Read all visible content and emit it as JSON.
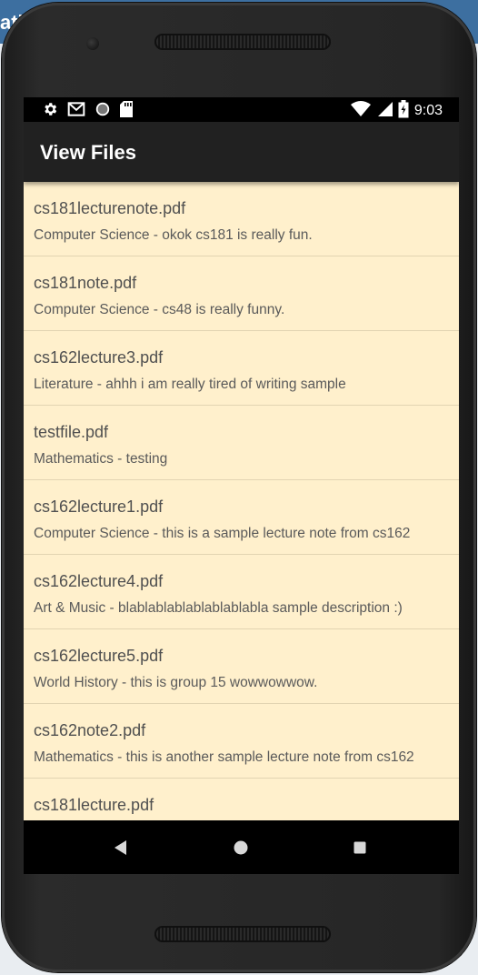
{
  "backdrop": {
    "title_fragment": "ati"
  },
  "status_bar": {
    "time": "9:03",
    "icons": [
      "gear-icon",
      "gmail-icon",
      "circle-icon",
      "sd-card-icon",
      "wifi-icon",
      "signal-icon",
      "battery-icon"
    ]
  },
  "app_bar": {
    "title": "View Files"
  },
  "files": [
    {
      "name": "cs181lecturenote.pdf",
      "description": "Computer Science - okok cs181 is really fun."
    },
    {
      "name": "cs181note.pdf",
      "description": "Computer Science - cs48 is really funny."
    },
    {
      "name": "cs162lecture3.pdf",
      "description": "Literature - ahhh i am really tired of writing sample"
    },
    {
      "name": "testfile.pdf",
      "description": "Mathematics - testing"
    },
    {
      "name": "cs162lecture1.pdf",
      "description": "Computer Science - this is a sample lecture note from cs162"
    },
    {
      "name": "cs162lecture4.pdf",
      "description": "Art & Music - blablablablablablablabla sample description :)"
    },
    {
      "name": "cs162lecture5.pdf",
      "description": "World History - this is group 15 wowwowwow."
    },
    {
      "name": "cs162note2.pdf",
      "description": "Mathematics - this is another sample lecture note from cs162"
    },
    {
      "name": "cs181lecture.pdf",
      "description": ""
    }
  ],
  "nav_bar": {
    "icons": [
      "back-icon",
      "home-icon",
      "recents-icon"
    ]
  },
  "colors": {
    "list_background": "#fff0cc",
    "app_bar": "#212121",
    "backdrop_blue": "#3d6fa0"
  }
}
